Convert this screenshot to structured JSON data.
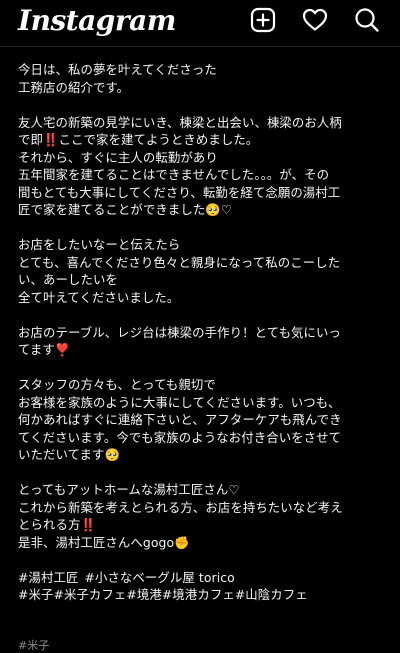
{
  "app": {
    "logo_text": "Instagram",
    "icons": [
      "new-post-icon",
      "heart-icon",
      "search-icon"
    ]
  },
  "caption": {
    "p1": [
      "今日は、私の夢を叶えてくださった",
      "工務店の紹介です。"
    ],
    "p2": [
      "友人宅の新築の見学にいき、棟梁と出会い、棟梁のお人柄",
      "で即‼️ここで家を建てようときめました。",
      "それから、すぐに主人の転勤があり",
      "五年間家を建てることはできませんでした。。。が、その",
      "間もとても大事にしてくださり、転勤を経て念願の湯村工",
      "匠で家を建てることができました🥺♡"
    ],
    "p3": [
      "お店をしたいなーと伝えたら",
      "とても、喜んでくださり色々と親身になって私のこーした",
      "い、あーしたいを",
      "全て叶えてくださいました。"
    ],
    "p4": [
      "お店のテーブル、レジ台は棟梁の手作り！とても気にいっ",
      "てます❣️"
    ],
    "p5": [
      "スタッフの方々も、とっても親切で",
      "お客様を家族のように大事にしてくださいます。いつも、",
      "何かあればすぐに連絡下さいと、アフターケアも飛んでき",
      "てくださいます。今でも家族のようなお付き合いをさせて",
      "いただいてます🥺"
    ],
    "p6": [
      "とってもアットホームな湯村工匠さん♡",
      "これから新築を考えとられる方、お店を持ちたいなど考え",
      "とられる方‼️",
      "是非、湯村工匠さんへgogo✊"
    ],
    "hashtags_line1": [
      "#湯村工匠",
      "#小さなベーグル屋 torico"
    ],
    "hashtags_line2": [
      "#米子",
      "#米子カフェ",
      "#境港",
      "#境港カフェ",
      "#山陰カフェ"
    ],
    "cut_text": "#米子"
  },
  "colors": {
    "background": "#000000",
    "text": "#f5f5f5",
    "divider": "#262626"
  }
}
